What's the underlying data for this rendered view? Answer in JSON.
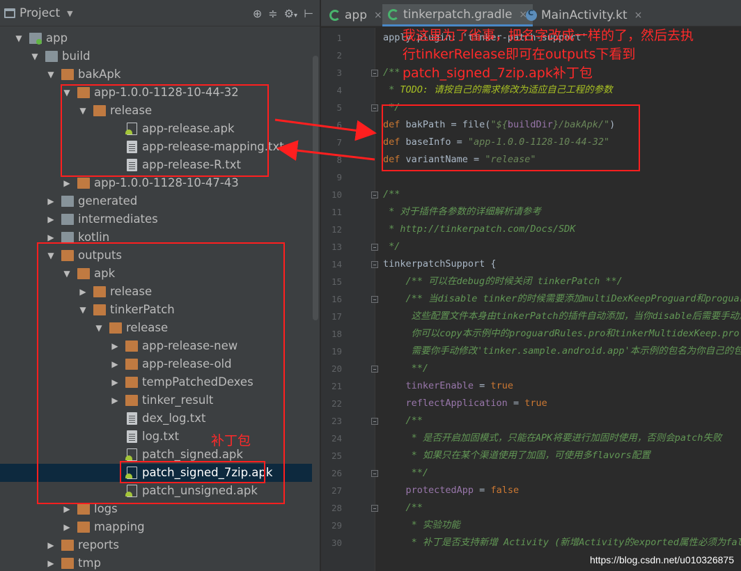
{
  "panel": {
    "title": "Project",
    "tools": [
      "target-icon",
      "collapse-icon",
      "gear-icon"
    ]
  },
  "tree": [
    {
      "name": "app",
      "type": "module",
      "state": "expanded"
    },
    {
      "name": "build",
      "type": "folder-grey",
      "state": "expanded"
    },
    {
      "name": "bakApk",
      "type": "folder-orange",
      "state": "expanded"
    },
    {
      "name": "app-1.0.0-1128-10-44-32",
      "type": "folder-orange",
      "state": "expanded"
    },
    {
      "name": "release",
      "type": "folder-orange",
      "state": "expanded"
    },
    {
      "name": "app-release.apk",
      "type": "apk"
    },
    {
      "name": "app-release-mapping.txt",
      "type": "file"
    },
    {
      "name": "app-release-R.txt",
      "type": "file"
    },
    {
      "name": "app-1.0.0-1128-10-47-43",
      "type": "folder-orange",
      "state": "collapsed"
    },
    {
      "name": "generated",
      "type": "folder-grey",
      "state": "collapsed"
    },
    {
      "name": "intermediates",
      "type": "folder-grey",
      "state": "collapsed"
    },
    {
      "name": "kotlin",
      "type": "folder-grey",
      "state": "collapsed"
    },
    {
      "name": "outputs",
      "type": "folder-orange",
      "state": "expanded"
    },
    {
      "name": "apk",
      "type": "folder-orange",
      "state": "expanded"
    },
    {
      "name": "release",
      "type": "folder-orange",
      "state": "collapsed"
    },
    {
      "name": "tinkerPatch",
      "type": "folder-orange",
      "state": "expanded"
    },
    {
      "name": "release",
      "type": "folder-orange",
      "state": "expanded"
    },
    {
      "name": "app-release-new",
      "type": "folder-orange",
      "state": "collapsed"
    },
    {
      "name": "app-release-old",
      "type": "folder-orange",
      "state": "collapsed"
    },
    {
      "name": "tempPatchedDexes",
      "type": "folder-orange",
      "state": "collapsed"
    },
    {
      "name": "tinker_result",
      "type": "folder-orange",
      "state": "collapsed"
    },
    {
      "name": "dex_log.txt",
      "type": "file"
    },
    {
      "name": "log.txt",
      "type": "file"
    },
    {
      "name": "patch_signed.apk",
      "type": "apk"
    },
    {
      "name": "patch_signed_7zip.apk",
      "type": "apk",
      "selected": true
    },
    {
      "name": "patch_unsigned.apk",
      "type": "apk"
    },
    {
      "name": "logs",
      "type": "folder-orange",
      "state": "collapsed"
    },
    {
      "name": "mapping",
      "type": "folder-orange",
      "state": "collapsed"
    },
    {
      "name": "reports",
      "type": "folder-orange",
      "state": "collapsed"
    },
    {
      "name": "tmp",
      "type": "folder-orange",
      "state": "collapsed"
    }
  ],
  "tabs": [
    {
      "label": "app",
      "icon": "gradle-icon",
      "active": false
    },
    {
      "label": "tinkerpatch.gradle",
      "icon": "gradle-icon",
      "active": true
    },
    {
      "label": "MainActivity.kt",
      "icon": "class-icon",
      "active": false
    }
  ],
  "code_lines": [
    {
      "n": "1",
      "segs": [
        {
          "t": "apply plugin: 'tinker-patch-support'",
          "c": "plain"
        }
      ]
    },
    {
      "n": "2",
      "segs": []
    },
    {
      "n": "3",
      "segs": [
        {
          "t": "/**",
          "c": "cm"
        }
      ]
    },
    {
      "n": "4",
      "segs": [
        {
          "t": " * ",
          "c": "cm"
        },
        {
          "t": "TODO:",
          "c": "todo"
        },
        {
          "t": " 请按自己的需求修改为适应自己工程的参数",
          "c": "todo"
        }
      ]
    },
    {
      "n": "5",
      "segs": [
        {
          "t": " */",
          "c": "cm"
        }
      ]
    },
    {
      "n": "6",
      "segs": [
        {
          "t": "def ",
          "c": "kw"
        },
        {
          "t": "bakPath = file(",
          "c": "plain"
        },
        {
          "t": "\"${",
          "c": "str"
        },
        {
          "t": "buildDir",
          "c": "var"
        },
        {
          "t": "}/bakApk/\"",
          "c": "str"
        },
        {
          "t": ")",
          "c": "plain"
        }
      ]
    },
    {
      "n": "7",
      "segs": [
        {
          "t": "def ",
          "c": "kw"
        },
        {
          "t": "baseInfo = ",
          "c": "plain"
        },
        {
          "t": "\"app-1.0.0-1128-10-44-32\"",
          "c": "str"
        }
      ]
    },
    {
      "n": "8",
      "segs": [
        {
          "t": "def ",
          "c": "kw"
        },
        {
          "t": "variantName = ",
          "c": "plain"
        },
        {
          "t": "\"release\"",
          "c": "str"
        }
      ]
    },
    {
      "n": "9",
      "segs": []
    },
    {
      "n": "10",
      "segs": [
        {
          "t": "/**",
          "c": "cm"
        }
      ]
    },
    {
      "n": "11",
      "segs": [
        {
          "t": " * 对于插件各参数的详细解析请参考",
          "c": "cm"
        }
      ]
    },
    {
      "n": "12",
      "segs": [
        {
          "t": " * http://tinkerpatch.com/Docs/SDK",
          "c": "cm"
        }
      ]
    },
    {
      "n": "13",
      "segs": [
        {
          "t": " */",
          "c": "cm"
        }
      ]
    },
    {
      "n": "14",
      "segs": [
        {
          "t": "tinkerpatchSupport {",
          "c": "plain"
        }
      ]
    },
    {
      "n": "15",
      "segs": [
        {
          "t": "    /** 可以在debug的时候关闭 tinkerPatch **/",
          "c": "cm"
        }
      ]
    },
    {
      "n": "16",
      "segs": [
        {
          "t": "    /** 当disable tinker的时候需要添加multiDexKeepProguard和proguardFiles",
          "c": "cm"
        }
      ]
    },
    {
      "n": "17",
      "segs": [
        {
          "t": "     这些配置文件本身由tinkerPatch的插件自动添加，当你disable后需要手动添加",
          "c": "cm"
        }
      ]
    },
    {
      "n": "18",
      "segs": [
        {
          "t": "     你可以copy本示例中的proguardRules.pro和tinkerMultidexKeep.pro",
          "c": "cm"
        }
      ]
    },
    {
      "n": "19",
      "segs": [
        {
          "t": "     需要你手动修改'tinker.sample.android.app'本示例的包名为你自己的包名",
          "c": "cm"
        }
      ]
    },
    {
      "n": "20",
      "segs": [
        {
          "t": "     **/",
          "c": "cm"
        }
      ]
    },
    {
      "n": "21",
      "segs": [
        {
          "t": "    tinkerEnable",
          "c": "var"
        },
        {
          "t": " = ",
          "c": "plain"
        },
        {
          "t": "true",
          "c": "kw"
        }
      ]
    },
    {
      "n": "22",
      "segs": [
        {
          "t": "    reflectApplication",
          "c": "var"
        },
        {
          "t": " = ",
          "c": "plain"
        },
        {
          "t": "true",
          "c": "kw"
        }
      ]
    },
    {
      "n": "23",
      "segs": [
        {
          "t": "    /**",
          "c": "cm"
        }
      ]
    },
    {
      "n": "24",
      "segs": [
        {
          "t": "     * 是否开启加固模式，只能在APK将要进行加固时使用，否则会patch失败",
          "c": "cm"
        }
      ]
    },
    {
      "n": "25",
      "segs": [
        {
          "t": "     * 如果只在某个渠道使用了加固，可使用多flavors配置",
          "c": "cm"
        }
      ]
    },
    {
      "n": "26",
      "segs": [
        {
          "t": "     **/",
          "c": "cm"
        }
      ]
    },
    {
      "n": "27",
      "segs": [
        {
          "t": "    protectedApp",
          "c": "var"
        },
        {
          "t": " = ",
          "c": "plain"
        },
        {
          "t": "false",
          "c": "kw"
        }
      ]
    },
    {
      "n": "28",
      "segs": [
        {
          "t": "    /**",
          "c": "cm"
        }
      ]
    },
    {
      "n": "29",
      "segs": [
        {
          "t": "     * 实验功能",
          "c": "cm"
        }
      ]
    },
    {
      "n": "30",
      "segs": [
        {
          "t": "     * 补丁是否支持新增 Activity (新增Activity的exported属性必须为false)",
          "c": "cm"
        }
      ]
    }
  ],
  "annotations": {
    "note_top_line1": "我这里为了省事，把名字改成一样的了，然后去执",
    "note_top_line2": "行tinkerRelease即可在outputs下看到",
    "note_top_line3": "patch_signed_7zip.apk补丁包",
    "note_patch": "补丁包",
    "color": "#ff1f1f"
  },
  "watermark": "https://blog.csdn.net/u010326875"
}
